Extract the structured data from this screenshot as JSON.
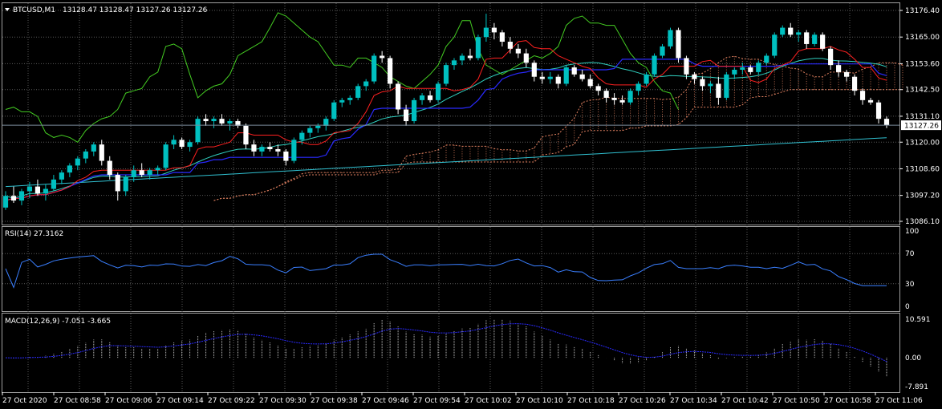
{
  "colors": {
    "background": "#000000",
    "grid": "#5a5a5a",
    "bull": "#00c0c0",
    "bear": "#ffffff",
    "tenkan": "#ff2020",
    "kijun": "#2a2aff",
    "chikou": "#44cc22",
    "bollinger": "#30d0c0",
    "ma_long": "#30c0d0",
    "cloud": "#e08060",
    "rsi": "#3a7fff",
    "macd_hist": "#c8c8c8",
    "macd_signal": "#2a2aff"
  },
  "header": {
    "symbol_label": "BTCUSD,M1",
    "ohlc_label": "13128.47 13128.47 13127.26 13127.26"
  },
  "rsi_panel": {
    "label": "RSI(14) 27.3162",
    "ticks": [
      "100",
      "70",
      "30",
      "0"
    ]
  },
  "macd_panel": {
    "label": "MACD(12,26,9) -7.051 -3.665",
    "ticks": [
      "10.591",
      "0.00",
      "-7.891"
    ]
  },
  "price_axis": {
    "ticks": [
      "13176.40",
      "13165.00",
      "13153.60",
      "13142.50",
      "13131.10",
      "13120.00",
      "13108.60",
      "13097.20",
      "13086.10"
    ],
    "current_price_label": "13127.26"
  },
  "time_axis": {
    "labels": [
      "27 Oct 2020",
      "27 Oct 08:58",
      "27 Oct 09:06",
      "27 Oct 09:14",
      "27 Oct 09:22",
      "27 Oct 09:30",
      "27 Oct 09:38",
      "27 Oct 09:46",
      "27 Oct 09:54",
      "27 Oct 10:02",
      "27 Oct 10:10",
      "27 Oct 10:18",
      "27 Oct 10:26",
      "27 Oct 10:34",
      "27 Oct 10:42",
      "27 Oct 10:50",
      "27 Oct 10:58",
      "27 Oct 11:06"
    ]
  },
  "chart_data": {
    "type": "candlestick",
    "symbol": "BTCUSD",
    "timeframe": "M1",
    "ylim": [
      13086.1,
      13176.4
    ],
    "candles": [
      {
        "o": 13092.0,
        "h": 13099.0,
        "l": 13091.0,
        "c": 13097.0
      },
      {
        "o": 13097.0,
        "h": 13101.0,
        "l": 13094.0,
        "c": 13095.0
      },
      {
        "o": 13095.0,
        "h": 13100.0,
        "l": 13093.0,
        "c": 13099.0
      },
      {
        "o": 13099.0,
        "h": 13103.0,
        "l": 13096.0,
        "c": 13101.0
      },
      {
        "o": 13101.0,
        "h": 13104.0,
        "l": 13097.0,
        "c": 13098.0
      },
      {
        "o": 13098.0,
        "h": 13102.0,
        "l": 13095.0,
        "c": 13100.0
      },
      {
        "o": 13100.0,
        "h": 13106.0,
        "l": 13099.0,
        "c": 13104.0
      },
      {
        "o": 13104.0,
        "h": 13108.0,
        "l": 13102.0,
        "c": 13107.0
      },
      {
        "o": 13107.0,
        "h": 13111.0,
        "l": 13105.0,
        "c": 13110.0
      },
      {
        "o": 13110.0,
        "h": 13114.0,
        "l": 13108.0,
        "c": 13113.0
      },
      {
        "o": 13113.0,
        "h": 13117.0,
        "l": 13111.0,
        "c": 13116.0
      },
      {
        "o": 13116.0,
        "h": 13120.0,
        "l": 13114.0,
        "c": 13119.0
      },
      {
        "o": 13119.0,
        "h": 13121.0,
        "l": 13110.0,
        "c": 13112.0
      },
      {
        "o": 13112.0,
        "h": 13114.0,
        "l": 13104.0,
        "c": 13106.0
      },
      {
        "o": 13106.0,
        "h": 13107.0,
        "l": 13095.0,
        "c": 13099.0
      },
      {
        "o": 13099.0,
        "h": 13106.0,
        "l": 13097.0,
        "c": 13105.0
      },
      {
        "o": 13105.0,
        "h": 13110.0,
        "l": 13103.0,
        "c": 13108.0
      },
      {
        "o": 13108.0,
        "h": 13111.0,
        "l": 13105.0,
        "c": 13106.0
      },
      {
        "o": 13106.0,
        "h": 13109.0,
        "l": 13104.0,
        "c": 13108.0
      },
      {
        "o": 13108.0,
        "h": 13110.0,
        "l": 13106.0,
        "c": 13109.0
      },
      {
        "o": 13109.0,
        "h": 13120.0,
        "l": 13108.0,
        "c": 13119.0
      },
      {
        "o": 13119.0,
        "h": 13123.0,
        "l": 13117.0,
        "c": 13121.0
      },
      {
        "o": 13121.0,
        "h": 13122.0,
        "l": 13117.0,
        "c": 13118.0
      },
      {
        "o": 13118.0,
        "h": 13121.0,
        "l": 13116.0,
        "c": 13120.0
      },
      {
        "o": 13120.0,
        "h": 13131.0,
        "l": 13119.0,
        "c": 13130.0
      },
      {
        "o": 13130.0,
        "h": 13132.0,
        "l": 13127.0,
        "c": 13129.0
      },
      {
        "o": 13129.0,
        "h": 13131.0,
        "l": 13126.0,
        "c": 13130.0
      },
      {
        "o": 13130.0,
        "h": 13132.0,
        "l": 13127.0,
        "c": 13128.0
      },
      {
        "o": 13128.0,
        "h": 13130.0,
        "l": 13125.0,
        "c": 13129.0
      },
      {
        "o": 13129.0,
        "h": 13130.0,
        "l": 13126.0,
        "c": 13127.0
      },
      {
        "o": 13127.0,
        "h": 13128.0,
        "l": 13117.0,
        "c": 13119.0
      },
      {
        "o": 13119.0,
        "h": 13121.0,
        "l": 13114.0,
        "c": 13116.0
      },
      {
        "o": 13116.0,
        "h": 13119.0,
        "l": 13114.0,
        "c": 13118.0
      },
      {
        "o": 13118.0,
        "h": 13120.0,
        "l": 13116.0,
        "c": 13117.0
      },
      {
        "o": 13117.0,
        "h": 13119.0,
        "l": 13114.0,
        "c": 13116.0
      },
      {
        "o": 13116.0,
        "h": 13117.0,
        "l": 13110.0,
        "c": 13112.0
      },
      {
        "o": 13112.0,
        "h": 13122.0,
        "l": 13111.0,
        "c": 13121.0
      },
      {
        "o": 13121.0,
        "h": 13125.0,
        "l": 13119.0,
        "c": 13124.0
      },
      {
        "o": 13124.0,
        "h": 13127.0,
        "l": 13122.0,
        "c": 13126.0
      },
      {
        "o": 13126.0,
        "h": 13128.0,
        "l": 13124.0,
        "c": 13127.0
      },
      {
        "o": 13127.0,
        "h": 13131.0,
        "l": 13125.0,
        "c": 13130.0
      },
      {
        "o": 13130.0,
        "h": 13138.0,
        "l": 13129.0,
        "c": 13137.0
      },
      {
        "o": 13137.0,
        "h": 13139.0,
        "l": 13135.0,
        "c": 13138.0
      },
      {
        "o": 13138.0,
        "h": 13140.0,
        "l": 13136.0,
        "c": 13139.0
      },
      {
        "o": 13139.0,
        "h": 13145.0,
        "l": 13138.0,
        "c": 13144.0
      },
      {
        "o": 13144.0,
        "h": 13147.0,
        "l": 13142.0,
        "c": 13146.0
      },
      {
        "o": 13146.0,
        "h": 13158.0,
        "l": 13145.0,
        "c": 13157.0
      },
      {
        "o": 13157.0,
        "h": 13159.0,
        "l": 13154.0,
        "c": 13156.0
      },
      {
        "o": 13156.0,
        "h": 13157.0,
        "l": 13143.0,
        "c": 13145.0
      },
      {
        "o": 13145.0,
        "h": 13146.0,
        "l": 13132.0,
        "c": 13134.0
      },
      {
        "o": 13134.0,
        "h": 13136.0,
        "l": 13127.0,
        "c": 13129.0
      },
      {
        "o": 13129.0,
        "h": 13139.0,
        "l": 13128.0,
        "c": 13138.0
      },
      {
        "o": 13138.0,
        "h": 13141.0,
        "l": 13136.0,
        "c": 13140.0
      },
      {
        "o": 13140.0,
        "h": 13142.0,
        "l": 13137.0,
        "c": 13138.0
      },
      {
        "o": 13138.0,
        "h": 13146.0,
        "l": 13137.0,
        "c": 13145.0
      },
      {
        "o": 13145.0,
        "h": 13154.0,
        "l": 13144.0,
        "c": 13153.0
      },
      {
        "o": 13153.0,
        "h": 13156.0,
        "l": 13151.0,
        "c": 13155.0
      },
      {
        "o": 13155.0,
        "h": 13158.0,
        "l": 13153.0,
        "c": 13157.0
      },
      {
        "o": 13157.0,
        "h": 13160.0,
        "l": 13155.0,
        "c": 13156.0
      },
      {
        "o": 13156.0,
        "h": 13166.0,
        "l": 13155.0,
        "c": 13165.0
      },
      {
        "o": 13165.0,
        "h": 13175.0,
        "l": 13163.0,
        "c": 13169.0
      },
      {
        "o": 13169.0,
        "h": 13171.0,
        "l": 13164.0,
        "c": 13167.0
      },
      {
        "o": 13167.0,
        "h": 13168.0,
        "l": 13161.0,
        "c": 13163.0
      },
      {
        "o": 13163.0,
        "h": 13165.0,
        "l": 13158.0,
        "c": 13160.0
      },
      {
        "o": 13160.0,
        "h": 13162.0,
        "l": 13156.0,
        "c": 13158.0
      },
      {
        "o": 13158.0,
        "h": 13160.0,
        "l": 13152.0,
        "c": 13154.0
      },
      {
        "o": 13154.0,
        "h": 13155.0,
        "l": 13146.0,
        "c": 13148.0
      },
      {
        "o": 13148.0,
        "h": 13150.0,
        "l": 13145.0,
        "c": 13147.0
      },
      {
        "o": 13147.0,
        "h": 13150.0,
        "l": 13145.0,
        "c": 13148.0
      },
      {
        "o": 13148.0,
        "h": 13149.0,
        "l": 13143.0,
        "c": 13145.0
      },
      {
        "o": 13145.0,
        "h": 13153.0,
        "l": 13144.0,
        "c": 13152.0
      },
      {
        "o": 13152.0,
        "h": 13153.0,
        "l": 13148.0,
        "c": 13149.0
      },
      {
        "o": 13149.0,
        "h": 13151.0,
        "l": 13146.0,
        "c": 13147.0
      },
      {
        "o": 13147.0,
        "h": 13149.0,
        "l": 13143.0,
        "c": 13144.0
      },
      {
        "o": 13144.0,
        "h": 13145.0,
        "l": 13140.0,
        "c": 13142.0
      },
      {
        "o": 13142.0,
        "h": 13143.0,
        "l": 13137.0,
        "c": 13139.0
      },
      {
        "o": 13139.0,
        "h": 13141.0,
        "l": 13136.0,
        "c": 13138.0
      },
      {
        "o": 13138.0,
        "h": 13140.0,
        "l": 13136.0,
        "c": 13137.0
      },
      {
        "o": 13137.0,
        "h": 13143.0,
        "l": 13136.0,
        "c": 13142.0
      },
      {
        "o": 13142.0,
        "h": 13146.0,
        "l": 13140.0,
        "c": 13145.0
      },
      {
        "o": 13145.0,
        "h": 13150.0,
        "l": 13144.0,
        "c": 13149.0
      },
      {
        "o": 13149.0,
        "h": 13158.0,
        "l": 13148.0,
        "c": 13157.0
      },
      {
        "o": 13157.0,
        "h": 13162.0,
        "l": 13156.0,
        "c": 13161.0
      },
      {
        "o": 13161.0,
        "h": 13169.0,
        "l": 13160.0,
        "c": 13168.0
      },
      {
        "o": 13168.0,
        "h": 13169.0,
        "l": 13154.0,
        "c": 13156.0
      },
      {
        "o": 13156.0,
        "h": 13157.0,
        "l": 13147.0,
        "c": 13149.0
      },
      {
        "o": 13149.0,
        "h": 13150.0,
        "l": 13145.0,
        "c": 13147.0
      },
      {
        "o": 13147.0,
        "h": 13148.0,
        "l": 13142.0,
        "c": 13144.0
      },
      {
        "o": 13144.0,
        "h": 13146.0,
        "l": 13141.0,
        "c": 13145.0
      },
      {
        "o": 13145.0,
        "h": 13148.0,
        "l": 13136.0,
        "c": 13139.0
      },
      {
        "o": 13139.0,
        "h": 13150.0,
        "l": 13138.0,
        "c": 13149.0
      },
      {
        "o": 13149.0,
        "h": 13152.0,
        "l": 13147.0,
        "c": 13151.0
      },
      {
        "o": 13151.0,
        "h": 13154.0,
        "l": 13149.0,
        "c": 13152.0
      },
      {
        "o": 13152.0,
        "h": 13153.0,
        "l": 13149.0,
        "c": 13150.0
      },
      {
        "o": 13150.0,
        "h": 13155.0,
        "l": 13149.0,
        "c": 13154.0
      },
      {
        "o": 13154.0,
        "h": 13158.0,
        "l": 13153.0,
        "c": 13157.0
      },
      {
        "o": 13157.0,
        "h": 13167.0,
        "l": 13156.0,
        "c": 13166.0
      },
      {
        "o": 13166.0,
        "h": 13170.0,
        "l": 13165.0,
        "c": 13169.0
      },
      {
        "o": 13169.0,
        "h": 13171.0,
        "l": 13165.0,
        "c": 13166.0
      },
      {
        "o": 13166.0,
        "h": 13168.0,
        "l": 13163.0,
        "c": 13167.0
      },
      {
        "o": 13167.0,
        "h": 13168.0,
        "l": 13160.0,
        "c": 13162.0
      },
      {
        "o": 13162.0,
        "h": 13167.0,
        "l": 13161.0,
        "c": 13166.0
      },
      {
        "o": 13166.0,
        "h": 13167.0,
        "l": 13159.0,
        "c": 13160.0
      },
      {
        "o": 13160.0,
        "h": 13161.0,
        "l": 13151.0,
        "c": 13153.0
      },
      {
        "o": 13153.0,
        "h": 13155.0,
        "l": 13148.0,
        "c": 13150.0
      },
      {
        "o": 13150.0,
        "h": 13151.0,
        "l": 13146.0,
        "c": 13148.0
      },
      {
        "o": 13148.0,
        "h": 13149.0,
        "l": 13140.0,
        "c": 13142.0
      },
      {
        "o": 13142.0,
        "h": 13143.0,
        "l": 13136.0,
        "c": 13138.0
      },
      {
        "o": 13138.0,
        "h": 13139.0,
        "l": 13136.0,
        "c": 13137.0
      },
      {
        "o": 13137.0,
        "h": 13138.0,
        "l": 13128.0,
        "c": 13130.0
      },
      {
        "o": 13130.0,
        "h": 13131.0,
        "l": 13126.0,
        "c": 13127.3
      }
    ],
    "current_price": 13127.26
  }
}
